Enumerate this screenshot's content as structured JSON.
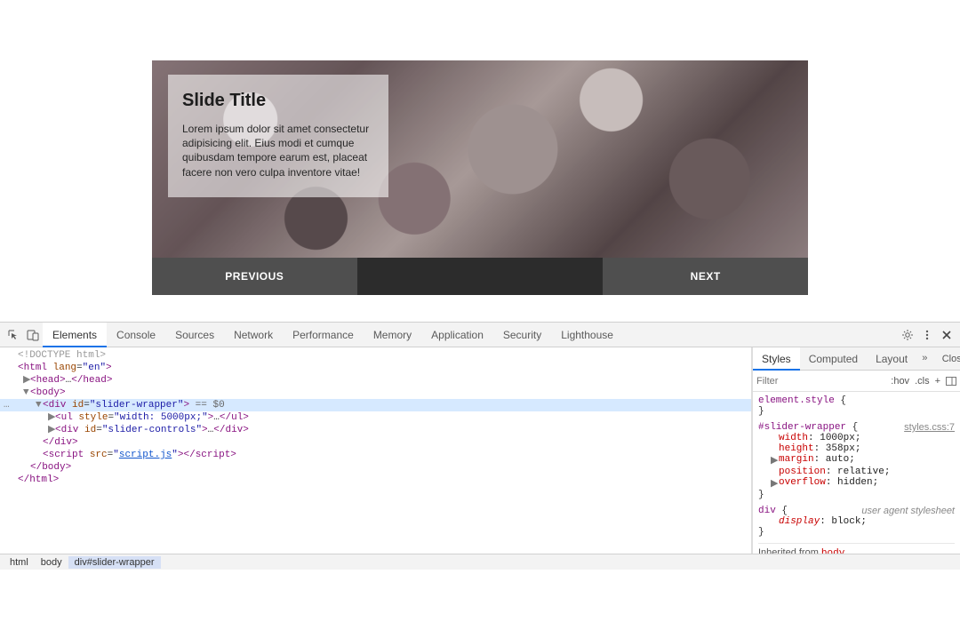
{
  "slide": {
    "title": "Slide Title",
    "body": "Lorem ipsum dolor sit amet consectetur adipisicing elit. Eius modi et cumque quibusdam tempore earum est, placeat facere non vero culpa inventore vitae!"
  },
  "controls": {
    "prev": "PREVIOUS",
    "next": "NEXT"
  },
  "devtools": {
    "dock_tooltip": "Close",
    "tabs": [
      "Elements",
      "Console",
      "Sources",
      "Network",
      "Performance",
      "Memory",
      "Application",
      "Security",
      "Lighthouse"
    ],
    "active_tab": "Elements",
    "dom_lines": [
      {
        "indent": 0,
        "arrow": "",
        "html": "<span class='com'>&lt;!DOCTYPE html&gt;</span>"
      },
      {
        "indent": 0,
        "arrow": "",
        "html": "<span class='p'>&lt;html</span> <span class='a'>lang</span>=<span class='v'>\"en\"</span><span class='p'>&gt;</span>"
      },
      {
        "indent": 1,
        "arrow": "▶",
        "html": "<span class='p'>&lt;head&gt;</span><span class='txt'>…</span><span class='p'>&lt;/head&gt;</span>"
      },
      {
        "indent": 1,
        "arrow": "▼",
        "html": "<span class='p'>&lt;body&gt;</span>"
      },
      {
        "indent": 2,
        "arrow": "▼",
        "gutter": "…",
        "selected": true,
        "html": "<span class='p'>&lt;div</span> <span class='a'>id</span>=<span class='v'>\"slider-wrapper\"</span><span class='p'>&gt;</span> <span class='eq'>== $0</span>"
      },
      {
        "indent": 3,
        "arrow": "▶",
        "html": "<span class='p'>&lt;ul</span> <span class='a'>style</span>=<span class='v'>\"width: 5000px;\"</span><span class='p'>&gt;</span><span class='txt'>…</span><span class='p'>&lt;/ul&gt;</span>"
      },
      {
        "indent": 3,
        "arrow": "▶",
        "html": "<span class='p'>&lt;div</span> <span class='a'>id</span>=<span class='v'>\"slider-controls\"</span><span class='p'>&gt;</span><span class='txt'>…</span><span class='p'>&lt;/div&gt;</span>"
      },
      {
        "indent": 2,
        "arrow": "",
        "html": "<span class='p'>&lt;/div&gt;</span>"
      },
      {
        "indent": 2,
        "arrow": "",
        "html": "<span class='p'>&lt;script</span> <span class='a'>src</span>=<span class='v'>\"<span class='link'>script.js</span>\"</span><span class='p'>&gt;&lt;/script&gt;</span>"
      },
      {
        "indent": 1,
        "arrow": "",
        "html": "<span class='p'>&lt;/body&gt;</span>"
      },
      {
        "indent": 0,
        "arrow": "",
        "html": "<span class='p'>&lt;/html&gt;</span>"
      }
    ],
    "styles": {
      "tabs": [
        "Styles",
        "Computed",
        "Layout"
      ],
      "active_tab": "Styles",
      "filter_placeholder": "Filter",
      "hov": ":hov",
      "cls": ".cls",
      "rules": [
        {
          "selector": "element.style",
          "source": "",
          "decls": []
        },
        {
          "selector": "#slider-wrapper",
          "source": "styles.css:7",
          "decls": [
            {
              "p": "width",
              "v": "1000px;"
            },
            {
              "p": "height",
              "v": "358px;"
            },
            {
              "p": "margin",
              "v": "auto;",
              "tri": "▶"
            },
            {
              "p": "position",
              "v": "relative;"
            },
            {
              "p": "overflow",
              "v": "hidden;",
              "tri": "▶"
            }
          ]
        },
        {
          "selector": "div",
          "source_uas": "user agent stylesheet",
          "decls": [
            {
              "p": "display",
              "v": "block;",
              "italic": true
            }
          ]
        }
      ],
      "inherited_label": "Inherited from",
      "inherited_from": "body"
    },
    "breadcrumb": [
      "html",
      "body",
      "div#slider-wrapper"
    ]
  }
}
